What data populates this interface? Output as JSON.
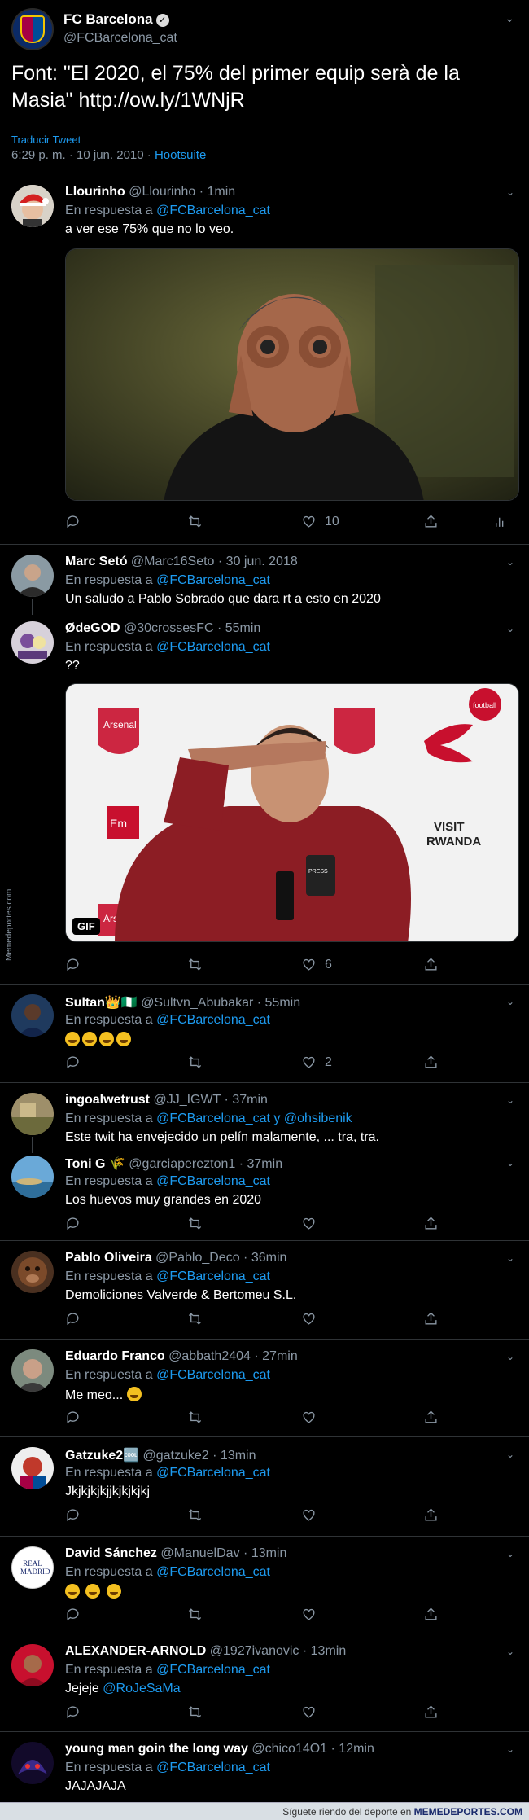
{
  "main_tweet": {
    "account_name": "FC Barcelona",
    "handle": "@FCBarcelona_cat",
    "text": "Font: \"El 2020, el 75% del primer equip serà de la Masia\" http://ow.ly/1WNjR",
    "translate": "Traducir Tweet",
    "timestamp": "6:29 p. m. · 10 jun. 2010 · ",
    "source": "Hootsuite"
  },
  "reply_prefix": "En respuesta a",
  "replies": [
    {
      "name": "Llourinho",
      "handle": "@Llourinho",
      "time": "· 1min",
      "reply_to": "@FCBarcelona_cat",
      "text": "a ver ese 75% que no lo veo.",
      "likes": "10"
    },
    {
      "name": "Marc Setó",
      "handle": "@Marc16Seto",
      "time": "· 30 jun. 2018",
      "reply_to": "@FCBarcelona_cat",
      "text": "Un saludo a Pablo Sobrado que dara rt a esto en 2020"
    },
    {
      "name": "ØdeGOD",
      "handle": "@30crossesFC",
      "time": "· 55min",
      "reply_to": "@FCBarcelona_cat",
      "text": "??",
      "likes": "6",
      "gif_label": "GIF",
      "media_texts": [
        "Arsenal",
        "football",
        "VISIT",
        "RWANDA",
        "Em",
        "PRESS",
        "Arsenal"
      ]
    },
    {
      "name": "Sultan👑🇳🇬",
      "handle": "@Sultvn_Abubakar",
      "time": "· 55min",
      "reply_to": "@FCBarcelona_cat",
      "likes": "2"
    },
    {
      "name": "ingoalwetrust",
      "handle": "@JJ_IGWT",
      "time": "· 37min",
      "reply_to": "@FCBarcelona_cat",
      "reply_join": " y ",
      "reply_to2": "@ohsibenik",
      "text": "Este twit ha envejecido un pelín malamente, ... tra, tra."
    },
    {
      "name": "Toni G 🌾",
      "handle": "@garciaperezton1",
      "time": "· 37min",
      "reply_to": "@FCBarcelona_cat",
      "text": "Los huevos muy grandes en 2020"
    },
    {
      "name": "Pablo Oliveira",
      "handle": "@Pablo_Deco",
      "time": "· 36min",
      "reply_to": "@FCBarcelona_cat",
      "text": "Demoliciones Valverde & Bertomeu S.L."
    },
    {
      "name": "Eduardo Franco",
      "handle": "@abbath2404",
      "time": "· 27min",
      "reply_to": "@FCBarcelona_cat",
      "text": "Me meo..."
    },
    {
      "name": "Gatzuke2🆒",
      "handle": "@gatzuke2",
      "time": "· 13min",
      "reply_to": "@FCBarcelona_cat",
      "text": "Jkjkjkjkjjkjkjkjkj"
    },
    {
      "name": "David Sánchez",
      "handle": "@ManuelDav",
      "time": "· 13min",
      "reply_to": "@FCBarcelona_cat",
      "avatar_text": "REAL MADRID"
    },
    {
      "name": "ALEXANDER-ARNOLD",
      "handle": "@1927ivanovic",
      "time": "· 13min",
      "reply_to": "@FCBarcelona_cat",
      "text": "Jejeje",
      "text_mention": "@RoJeSaMa"
    },
    {
      "name": "young man goin the long way",
      "handle": "@chico14O1",
      "time": "· 12min",
      "reply_to": "@FCBarcelona_cat",
      "text": "JAJAJAJA"
    }
  ],
  "side_watermark": "Memedeportes.com",
  "footer": {
    "prefix": "Síguete riendo del deporte en ",
    "brand": "MEMEDEPORTES.COM"
  },
  "colors": {
    "background": "#000000",
    "link": "#1d9bf0",
    "muted": "#8b98a5",
    "divider": "#2f3336"
  }
}
